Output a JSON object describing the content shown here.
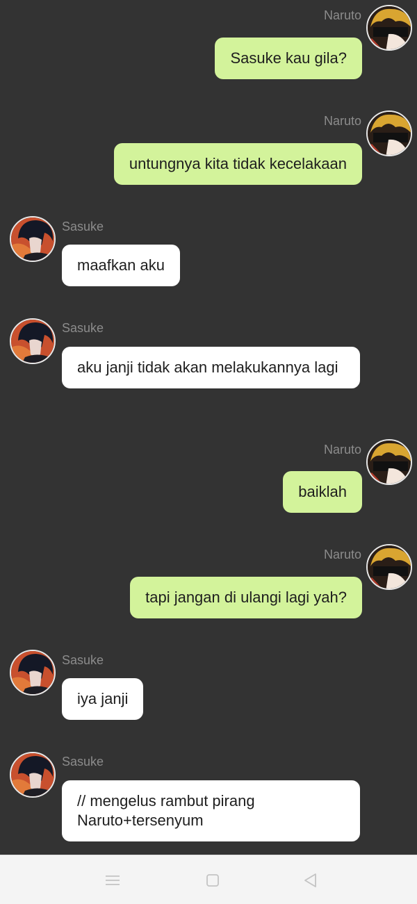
{
  "messages": [
    {
      "from": "Naruto",
      "side": "out",
      "text": "Sasuke kau gila?"
    },
    {
      "from": "Naruto",
      "side": "out",
      "text": "untungnya kita tidak kecelakaan"
    },
    {
      "from": "Sasuke",
      "side": "in",
      "text": "maafkan aku"
    },
    {
      "from": "Sasuke",
      "side": "in",
      "text": "aku janji tidak akan melakukannya lagi"
    },
    {
      "from": "Naruto",
      "side": "out",
      "text": "baiklah"
    },
    {
      "from": "Naruto",
      "side": "out",
      "text": "tapi jangan di ulangi lagi yah?"
    },
    {
      "from": "Sasuke",
      "side": "in",
      "text": "iya janji"
    },
    {
      "from": "Sasuke",
      "side": "in",
      "text": "// mengelus rambut pirang Naruto+tersenyum"
    }
  ],
  "colors": {
    "background": "#333333",
    "outgoing_bubble": "#d3f39b",
    "incoming_bubble": "#ffffff",
    "sender_name": "#8c8c8c",
    "navbar": "#f4f4f4"
  },
  "navbar": {
    "icons": [
      "menu-icon",
      "home-square-icon",
      "back-triangle-icon"
    ]
  }
}
